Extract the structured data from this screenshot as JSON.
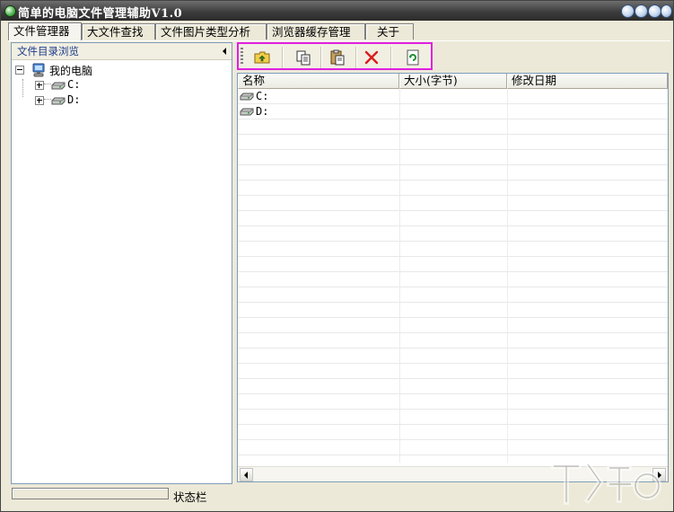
{
  "window": {
    "title": "简单的电脑文件管理辅助V1.0"
  },
  "tabs": [
    {
      "label": "文件管理器",
      "active": true
    },
    {
      "label": "大文件查找",
      "active": false
    },
    {
      "label": "文件图片类型分析",
      "active": false
    },
    {
      "label": "浏览器缓存管理",
      "active": false
    },
    {
      "label": "关于",
      "active": false
    }
  ],
  "tree_panel": {
    "header": "文件目录浏览",
    "root": {
      "label": "我的电脑",
      "icon": "computer-icon"
    },
    "drives": [
      {
        "label": "C:",
        "icon": "drive-icon"
      },
      {
        "label": "D:",
        "icon": "drive-icon"
      }
    ]
  },
  "toolbar": {
    "buttons": [
      {
        "name": "up-folder",
        "icon": "folder-up-icon"
      },
      {
        "name": "copy",
        "icon": "copy-icon"
      },
      {
        "name": "paste",
        "icon": "paste-icon"
      },
      {
        "name": "delete",
        "icon": "delete-x-icon"
      },
      {
        "name": "refresh",
        "icon": "refresh-icon"
      }
    ],
    "highlight_color": "#e020e0"
  },
  "file_list": {
    "columns": [
      "名称",
      "大小(字节)",
      "修改日期"
    ],
    "rows": [
      {
        "name": "C:",
        "size": "",
        "modified": ""
      },
      {
        "name": "D:",
        "size": "",
        "modified": ""
      }
    ]
  },
  "statusbar": {
    "label": "状态栏"
  }
}
